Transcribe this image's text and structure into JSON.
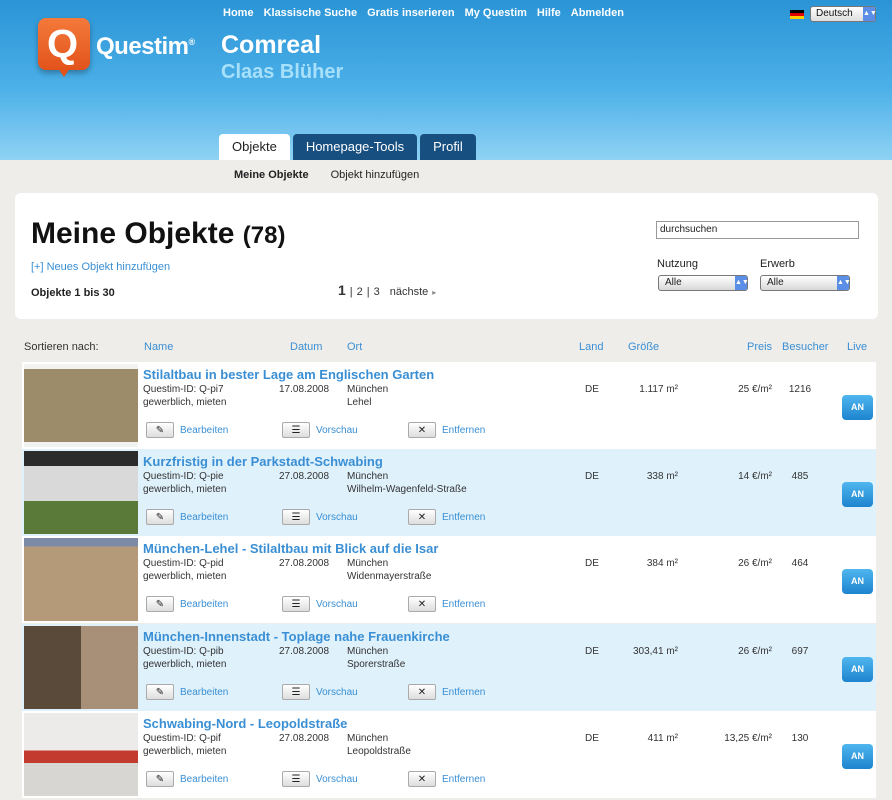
{
  "topnav": [
    "Home",
    "Klassische Suche",
    "Gratis inserieren",
    "My Questim",
    "Hilfe",
    "Abmelden"
  ],
  "language": "Deutsch",
  "brand": {
    "logo_letter": "Q",
    "logo_text": "Questim",
    "logo_mark": "®",
    "company": "Comreal",
    "person": "Claas Blüher"
  },
  "tabs": [
    "Objekte",
    "Homepage-Tools",
    "Profil"
  ],
  "subnav": [
    "Meine Objekte",
    "Objekt hinzufügen"
  ],
  "panel": {
    "title": "Meine Objekte",
    "count": "(78)",
    "add_link": "[+] Neues Objekt hinzufügen",
    "range": "Objekte 1 bis 30",
    "pages": [
      "1",
      "2",
      "3"
    ],
    "next": "nächste",
    "search_value": "durchsuchen",
    "filter_nutzung_label": "Nutzung",
    "filter_nutzung_value": "Alle",
    "filter_erwerb_label": "Erwerb",
    "filter_erwerb_value": "Alle"
  },
  "columns": {
    "sort_label": "Sortieren nach:",
    "name": "Name",
    "datum": "Datum",
    "ort": "Ort",
    "land": "Land",
    "groesse": "Größe",
    "preis": "Preis",
    "besucher": "Besucher",
    "live": "Live"
  },
  "actions": {
    "edit": "Bearbeiten",
    "preview": "Vorschau",
    "remove": "Entfernen",
    "live": "AN"
  },
  "rows": [
    {
      "title": "Stilaltbau in bester Lage am Englischen Garten",
      "id": "Questim-ID: Q-pi7",
      "type": "gewerblich, mieten",
      "date": "17.08.2008",
      "city": "München",
      "street": "Lehel",
      "country": "DE",
      "size": "1.117 m²",
      "price": "25 €/m²",
      "visitors": "1216"
    },
    {
      "title": "Kurzfristig in der Parkstadt-Schwabing",
      "id": "Questim-ID: Q-pie",
      "type": "gewerblich, mieten",
      "date": "27.08.2008",
      "city": "München",
      "street": "Wilhelm-Wagenfeld-Straße",
      "country": "DE",
      "size": "338 m²",
      "price": "14 €/m²",
      "visitors": "485"
    },
    {
      "title": "München-Lehel - Stilaltbau mit Blick auf die Isar",
      "id": "Questim-ID: Q-pid",
      "type": "gewerblich, mieten",
      "date": "27.08.2008",
      "city": "München",
      "street": "Widenmayerstraße",
      "country": "DE",
      "size": "384 m²",
      "price": "26 €/m²",
      "visitors": "464"
    },
    {
      "title": "München-Innenstadt - Toplage nahe Frauenkirche",
      "id": "Questim-ID: Q-pib",
      "type": "gewerblich, mieten",
      "date": "27.08.2008",
      "city": "München",
      "street": "Sporerstraße",
      "country": "DE",
      "size": "303,41 m²",
      "price": "26 €/m²",
      "visitors": "697"
    },
    {
      "title": "Schwabing-Nord - Leopoldstraße",
      "id": "Questim-ID: Q-pif",
      "type": "gewerblich, mieten",
      "date": "27.08.2008",
      "city": "München",
      "street": "Leopoldstraße",
      "country": "DE",
      "size": "411 m²",
      "price": "13,25 €/m²",
      "visitors": "130"
    }
  ]
}
